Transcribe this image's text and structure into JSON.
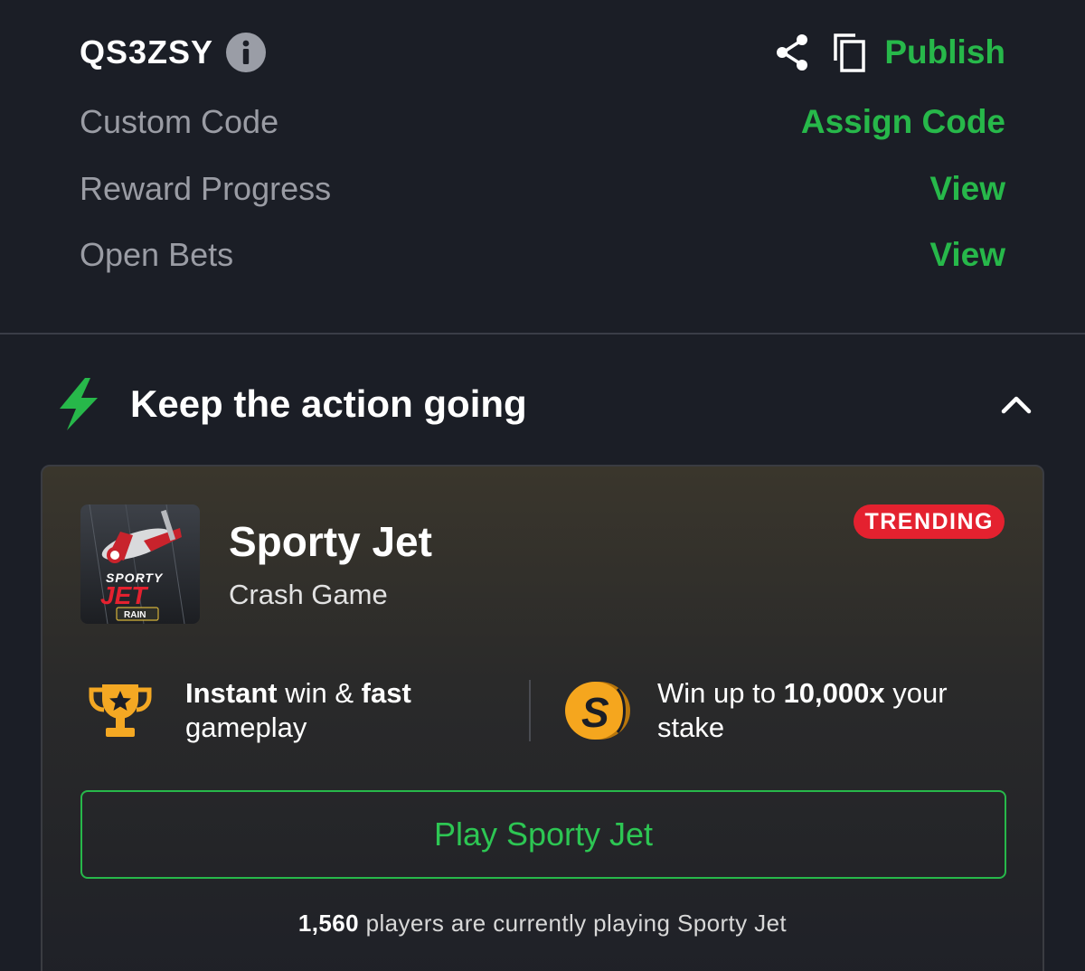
{
  "booking": {
    "code": "QS3ZSY",
    "publish_label": "Publish"
  },
  "info_rows": [
    {
      "label": "Custom Code",
      "action": "Assign Code"
    },
    {
      "label": "Reward Progress",
      "action": "View"
    },
    {
      "label": "Open Bets",
      "action": "View"
    }
  ],
  "section": {
    "title": "Keep the action going"
  },
  "game": {
    "title": "Sporty Jet",
    "subtitle": "Crash Game",
    "badge": "TRENDING",
    "thumbnail_text": {
      "line1": "SPORTY",
      "line2": "JET",
      "tag": "RAIN"
    },
    "features": [
      {
        "bold1": "Instant",
        "text1": " win & ",
        "bold2": "fast",
        "text2": " gameplay"
      },
      {
        "text1": "Win up to ",
        "bold1": "10,000x",
        "text2": " your stake"
      }
    ],
    "play_label": "Play Sporty Jet",
    "players": {
      "count": "1,560",
      "text": " players are currently playing Sporty Jet"
    }
  },
  "colors": {
    "background": "#1b1e26",
    "accent_green": "#27b84a",
    "badge_red": "#e4212f",
    "muted_text": "#9a9ca4"
  },
  "icons": [
    "info-icon",
    "share-icon",
    "copy-icon",
    "lightning-bolt-icon",
    "chevron-up-icon",
    "trophy-icon",
    "coin-icon"
  ]
}
